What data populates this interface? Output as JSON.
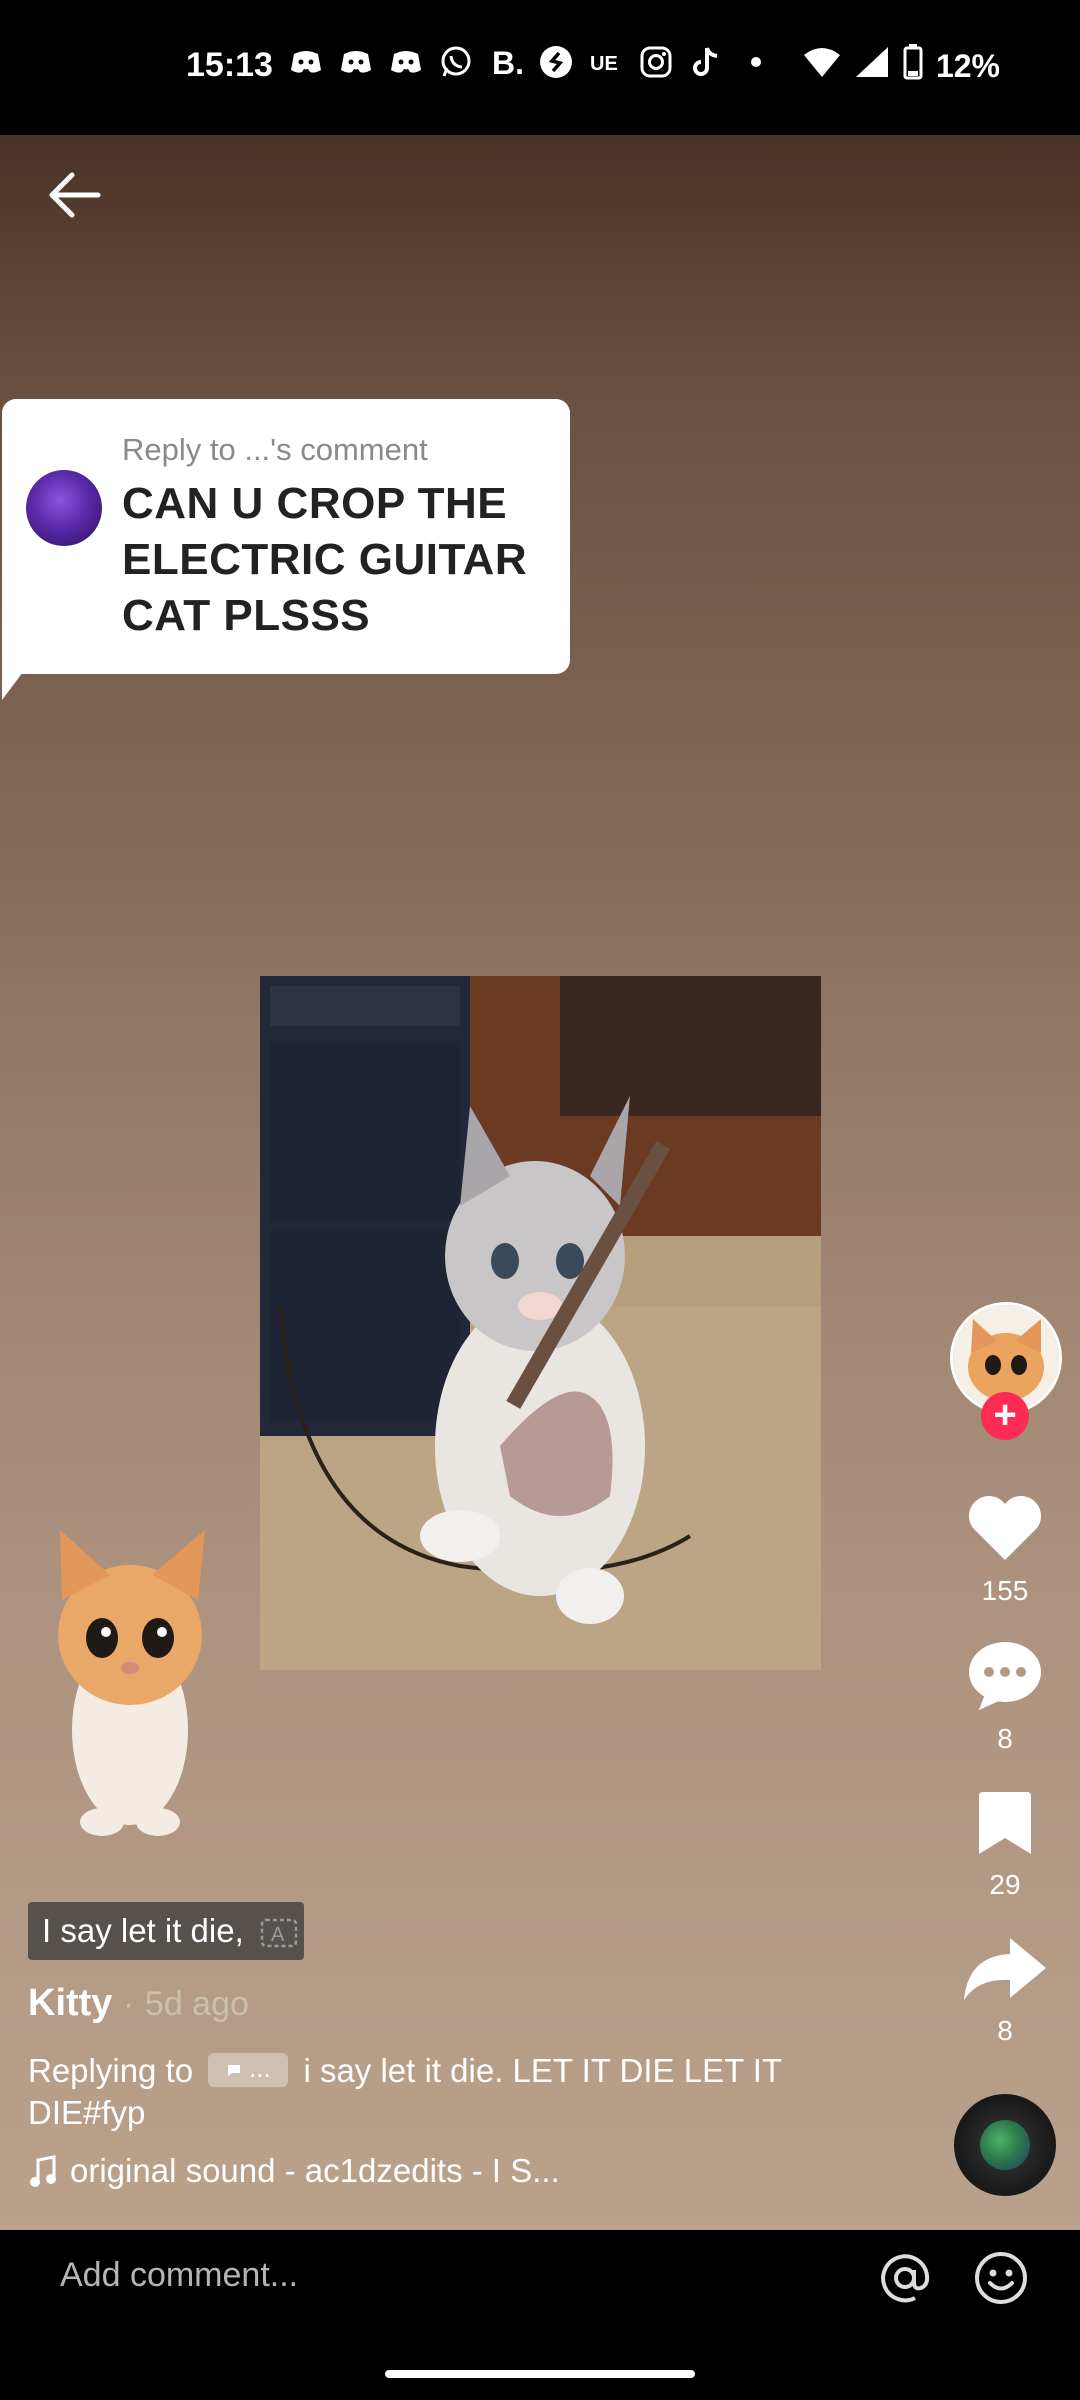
{
  "status_bar": {
    "time": "15:13",
    "notification_icons": [
      "discord-icon",
      "discord-icon",
      "discord-icon",
      "whatsapp-icon",
      "b-icon",
      "shazam-icon",
      "ue-icon",
      "instagram-icon",
      "tiktok-icon",
      "dot-icon"
    ],
    "battery": "12%"
  },
  "reply_card": {
    "header": "Reply to ...'s comment",
    "comment": "CAN U CROP THE ELECTRIC GUITAR CAT PLSSS"
  },
  "caption_chip": {
    "text": "I say let it die,"
  },
  "author": {
    "name": "Kitty",
    "separator": "·",
    "time_ago": "5d ago"
  },
  "description": {
    "prefix": "Replying to",
    "chip": "...",
    "body": "i say let it die. LET IT DIE LET IT DIE#fyp"
  },
  "music": {
    "label": "original sound - ac1dzedits - I  S..."
  },
  "rail": {
    "likes": "155",
    "comments": "8",
    "saves": "29",
    "shares": "8",
    "follow_symbol": "+"
  },
  "comment_bar": {
    "placeholder": "Add comment..."
  },
  "colors": {
    "accent": "#fe2c55",
    "background_top": "#4a3226",
    "background_bottom": "#b9a18c"
  }
}
